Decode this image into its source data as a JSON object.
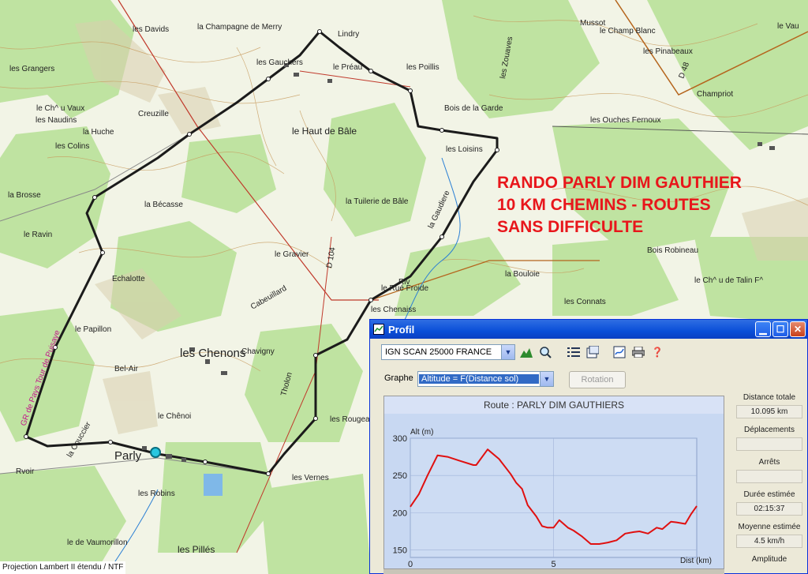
{
  "map": {
    "places": [
      "les Davids",
      "la Champagne de Merry",
      "les Grangers",
      "les Gauchers",
      "Lindry",
      "le Préau",
      "les Poillis",
      "les Zouaves",
      "Mussot",
      "le Champ Blanc",
      "le Vau",
      "les Pinabeaux",
      "Champriot",
      "le Ch^ u Vaux",
      "les Naudins",
      "la Huche",
      "Creuzille",
      "les Colins",
      "le Haut de Bâle",
      "Bois de la Garde",
      "les Loisins",
      "les Ouches Fernoux",
      "la Bécasse",
      "la Tuilerie de Bâle",
      "le Gravier",
      "Echalotte",
      "le Papillon",
      "Bel-Air",
      "les Chenons",
      "Chavigny",
      "le Chênoi",
      "la Couccier",
      "Parly",
      "les Robins",
      "les Pillés",
      "les Rougeaux",
      "les Vernes",
      "la Bouloie",
      "Bois Robineau",
      "le Ch^ u de Talin F^",
      "les Connats",
      "Tholon",
      "le Rué Froide",
      "Rvoir",
      "les Chenaiss",
      "GR de Pays Tour de Puisaye",
      "D 104",
      "Cabeuillard",
      "la Gaudiere",
      "D 48",
      "le Ravin",
      "la Brosse",
      "le de Vaumorillon",
      "Riv"
    ],
    "overlay_title_lines": [
      "RANDO PARLY DIM GAUTHIER",
      "10 KM CHEMINS - ROUTES",
      "SANS DIFFICULTE"
    ],
    "projection": "Projection Lambert II étendu / NTF",
    "route_color": "#1b1b1b",
    "overlay_color": "#e8161b"
  },
  "window": {
    "title": "Profil",
    "title_icon": "chart-window-icon",
    "controls": [
      "minimize-icon",
      "maximize-icon",
      "close-icon"
    ],
    "map_source": "IGN SCAN 25000 FRANCE",
    "toolbar_icons": [
      "terrain-icon",
      "zoom-icon",
      "list-icon",
      "properties-icon",
      "export-icon",
      "print-icon",
      "help-icon"
    ],
    "graphe_label": "Graphe",
    "graphe_value": "Altitude = F(Distance sol)",
    "rotation_label": "Rotation",
    "chart_header": "Route : PARLY DIM GAUTHIERS",
    "stats": {
      "distance_label": "Distance totale",
      "distance_value": "10.095 km",
      "deplacements_label": "Déplacements",
      "deplacements_value": "",
      "arrets_label": "Arrêts",
      "arrets_value": "",
      "duree_label": "Durée estimée",
      "duree_value": "02:15:37",
      "moyenne_label": "Moyenne estimée",
      "moyenne_value": "4.5 km/h",
      "amplitude_label": "Amplitude",
      "amplitude_value": ""
    }
  },
  "chart_data": {
    "type": "line",
    "title": "Route : PARLY DIM GAUTHIERS",
    "ylabel": "Alt (m)",
    "xlabel": "Dist (km)",
    "xlim": [
      0,
      10
    ],
    "ylim": [
      140,
      300
    ],
    "yticks": [
      150,
      200,
      250,
      300
    ],
    "xticks": [
      0,
      5
    ],
    "grid": true,
    "series": [
      {
        "color": "#e01010",
        "x": [
          0,
          0.3,
          0.6,
          0.95,
          1.3,
          1.7,
          2.2,
          2.3,
          2.7,
          3.1,
          3.5,
          3.7,
          3.9,
          4.1,
          4.4,
          4.6,
          4.8,
          5.0,
          5.2,
          5.5,
          5.7,
          6.0,
          6.3,
          6.6,
          6.9,
          7.2,
          7.5,
          7.8,
          8.0,
          8.3,
          8.6,
          8.8,
          9.1,
          9.3,
          9.6,
          9.8,
          10.0
        ],
        "y": [
          208,
          225,
          250,
          277,
          275,
          270,
          264,
          264,
          285,
          272,
          252,
          240,
          232,
          210,
          195,
          182,
          180,
          180,
          190,
          180,
          176,
          168,
          158,
          158,
          160,
          163,
          172,
          174,
          175,
          172,
          180,
          178,
          188,
          187,
          185,
          198,
          209
        ]
      }
    ]
  }
}
